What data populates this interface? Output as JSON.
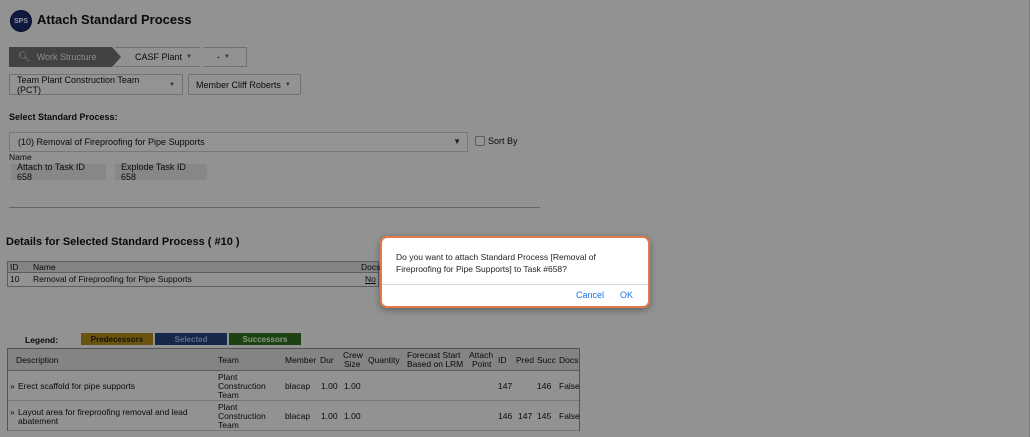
{
  "app": {
    "logo_text": "SPS",
    "title": "Attach Standard Process"
  },
  "breadcrumb": {
    "search_label": "Work Structure",
    "plant_label": "CASF Plant",
    "dash_label": "-"
  },
  "filters": {
    "team_button": "Team  Plant Construction Team (PCT)",
    "member_button": "Member  Cliff Roberts"
  },
  "select_section": {
    "label": "Select Standard Process:",
    "selected_value": "(10) Removal of Fireproofing for Pipe Supports",
    "sort_by_label": "Sort By",
    "name_label": "Name",
    "attach_button": "Attach to Task ID 658",
    "explode_button": "Explode Task ID 658"
  },
  "details": {
    "title": "Details for Selected Standard Process ( #10 )",
    "columns": [
      "ID",
      "Name",
      "Docs"
    ],
    "row": {
      "id": "10",
      "name": "Removal of Fireproofing for Pipe Supports",
      "docs": "No"
    }
  },
  "legend": {
    "label": "Legend:",
    "items": [
      {
        "label": "Predecessors",
        "color": "#b28c1f"
      },
      {
        "label": "Selected",
        "color": "#26427a"
      },
      {
        "label": "Successors",
        "color": "#2f6f1f"
      }
    ]
  },
  "grid": {
    "headers": {
      "description": "Description",
      "team": "Team",
      "member": "Member",
      "dur": "Dur",
      "crew_size_1": "Crew",
      "crew_size_2": "Size",
      "quantity": "Quantity",
      "forecast_1": "Forecast Start",
      "forecast_2": "Based on LRM",
      "attach_1": "Attach",
      "attach_2": "Point",
      "id": "ID",
      "pred": "Pred",
      "succ": "Succ",
      "docs": "Docs"
    },
    "rows": [
      {
        "marker": "»",
        "description_1": "Erect scaffold for pipe supports",
        "description_2": "",
        "team_1": "Plant",
        "team_2": "Construction",
        "team_3": "Team",
        "member": "blacap",
        "dur": "1.00",
        "crew": "1.00",
        "id": "147",
        "pred": "",
        "succ": "146",
        "docs": "False"
      },
      {
        "marker": "»",
        "description_1": "Layout area for fireproofing removal and lead",
        "description_2": "abatement",
        "team_1": "Plant",
        "team_2": "Construction",
        "team_3": "Team",
        "member": "blacap",
        "dur": "1.00",
        "crew": "1.00",
        "id": "146",
        "pred": "147",
        "succ": "145",
        "docs": "False"
      }
    ]
  },
  "dialog": {
    "message": "Do you want to attach Standard Process [Removal of Fireproofing for Pipe Supports] to Task #658?",
    "cancel_label": "Cancel",
    "ok_label": "OK",
    "border_color": "#e07a4a",
    "button_color": "#1a73e8"
  }
}
